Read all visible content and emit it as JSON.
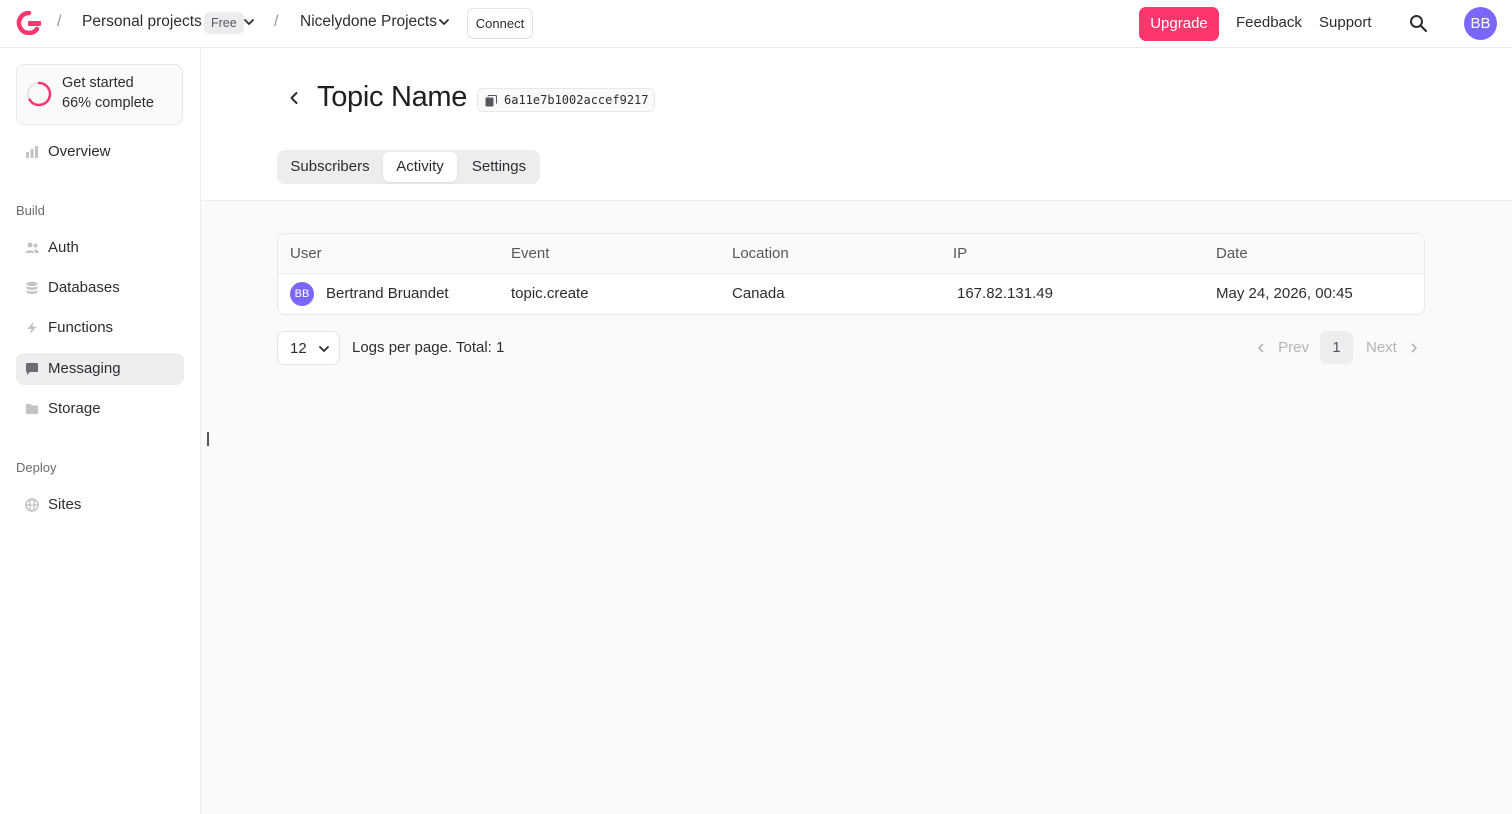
{
  "header": {
    "org_name": "Personal projects",
    "plan_badge": "Free",
    "project_name": "Nicelydone Projects",
    "connect_label": "Connect",
    "upgrade_label": "Upgrade",
    "feedback_label": "Feedback",
    "support_label": "Support",
    "avatar_initials": "BB"
  },
  "sidebar": {
    "get_started": {
      "title": "Get started",
      "progress_text": "66% complete",
      "progress": 0.66
    },
    "overview_label": "Overview",
    "build_section": "Build",
    "build_items": [
      {
        "label": "Auth",
        "icon": "users-icon"
      },
      {
        "label": "Databases",
        "icon": "database-icon"
      },
      {
        "label": "Functions",
        "icon": "lightning-icon"
      },
      {
        "label": "Messaging",
        "icon": "chat-icon"
      },
      {
        "label": "Storage",
        "icon": "folder-icon"
      }
    ],
    "deploy_section": "Deploy",
    "deploy_items": [
      {
        "label": "Sites",
        "icon": "globe-icon"
      }
    ]
  },
  "page": {
    "title": "Topic Name",
    "topic_id": "6a11e7b1002accef9217",
    "tabs": [
      {
        "label": "Subscribers"
      },
      {
        "label": "Activity"
      },
      {
        "label": "Settings"
      }
    ],
    "active_tab": "Activity"
  },
  "table": {
    "columns": [
      "User",
      "Event",
      "Location",
      "IP",
      "Date"
    ],
    "rows": [
      {
        "avatar": "BB",
        "user": "Bertrand Bruandet",
        "event": "topic.create",
        "location": "Canada",
        "ip": "167.82.131.49",
        "date": "May 24, 2026, 00:45"
      }
    ]
  },
  "pagination": {
    "limit": "12",
    "logs_text": "Logs per page. Total: 1",
    "prev_label": "Prev",
    "next_label": "Next",
    "current_page": "1"
  },
  "colors": {
    "accent": "#fd366e",
    "avatar": "#7c67fe"
  }
}
